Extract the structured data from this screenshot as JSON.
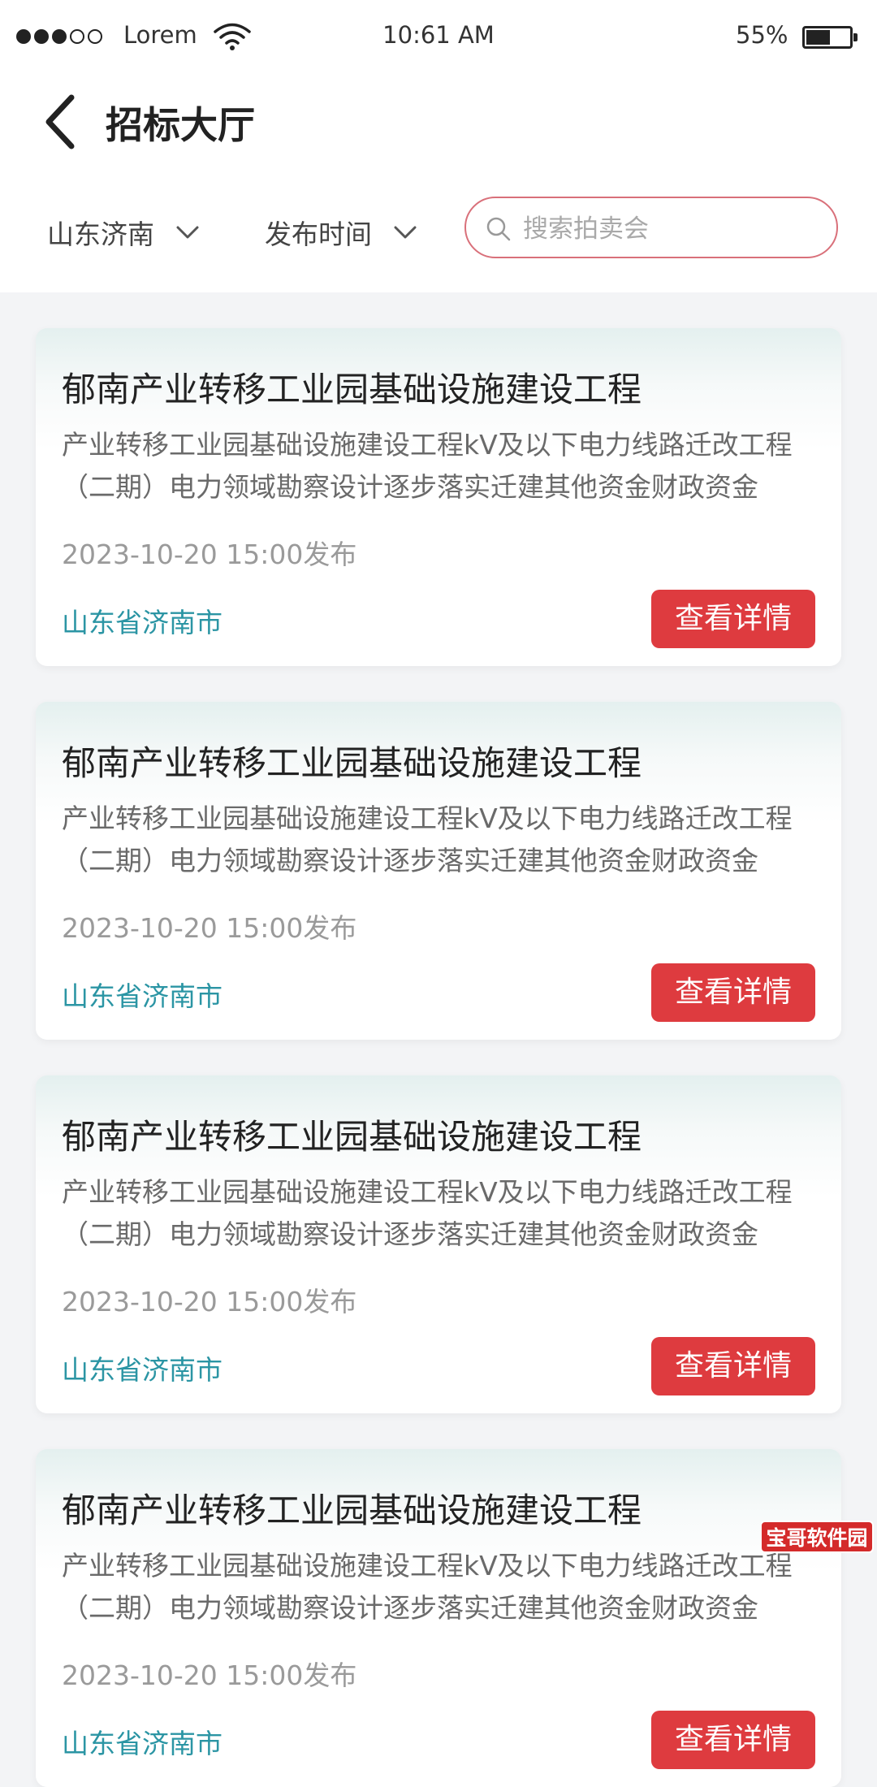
{
  "status_bar": {
    "carrier": "Lorem",
    "time": "10:61 AM",
    "battery": "55%",
    "battery_level": 0.55
  },
  "header": {
    "title": "招标大厅",
    "back_icon": "chevron-left-icon"
  },
  "filters": {
    "region": "山东济南",
    "time": "发布时间",
    "search_placeholder": "搜索拍卖会",
    "search_value": ""
  },
  "cards": [
    {
      "title": "郁南产业转移工业园基础设施建设工程",
      "description": "产业转移工业园基础设施建设工程kV及以下电力线路迁改工程（二期）电力领域勘察设计逐步落实迁建其他资金财政资金",
      "date": "2023-10-20 15:00发布",
      "location": "山东省济南市",
      "button": "查看详情"
    },
    {
      "title": "郁南产业转移工业园基础设施建设工程",
      "description": "产业转移工业园基础设施建设工程kV及以下电力线路迁改工程（二期）电力领域勘察设计逐步落实迁建其他资金财政资金",
      "date": "2023-10-20 15:00发布",
      "location": "山东省济南市",
      "button": "查看详情"
    },
    {
      "title": "郁南产业转移工业园基础设施建设工程",
      "description": "产业转移工业园基础设施建设工程kV及以下电力线路迁改工程（二期）电力领域勘察设计逐步落实迁建其他资金财政资金",
      "date": "2023-10-20 15:00发布",
      "location": "山东省济南市",
      "button": "查看详情"
    },
    {
      "title": "郁南产业转移工业园基础设施建设工程",
      "description": "产业转移工业园基础设施建设工程kV及以下电力线路迁改工程（二期）电力领域勘察设计逐步落实迁建其他资金财政资金",
      "date": "2023-10-20 15:00发布",
      "location": "山东省济南市",
      "button": "查看详情"
    }
  ],
  "watermark": "宝哥软件园",
  "colors": {
    "accent_red": "#de3b3f",
    "location_teal": "#2b95a4",
    "search_border": "#d9707a",
    "page_bg": "#f3f4f6"
  }
}
